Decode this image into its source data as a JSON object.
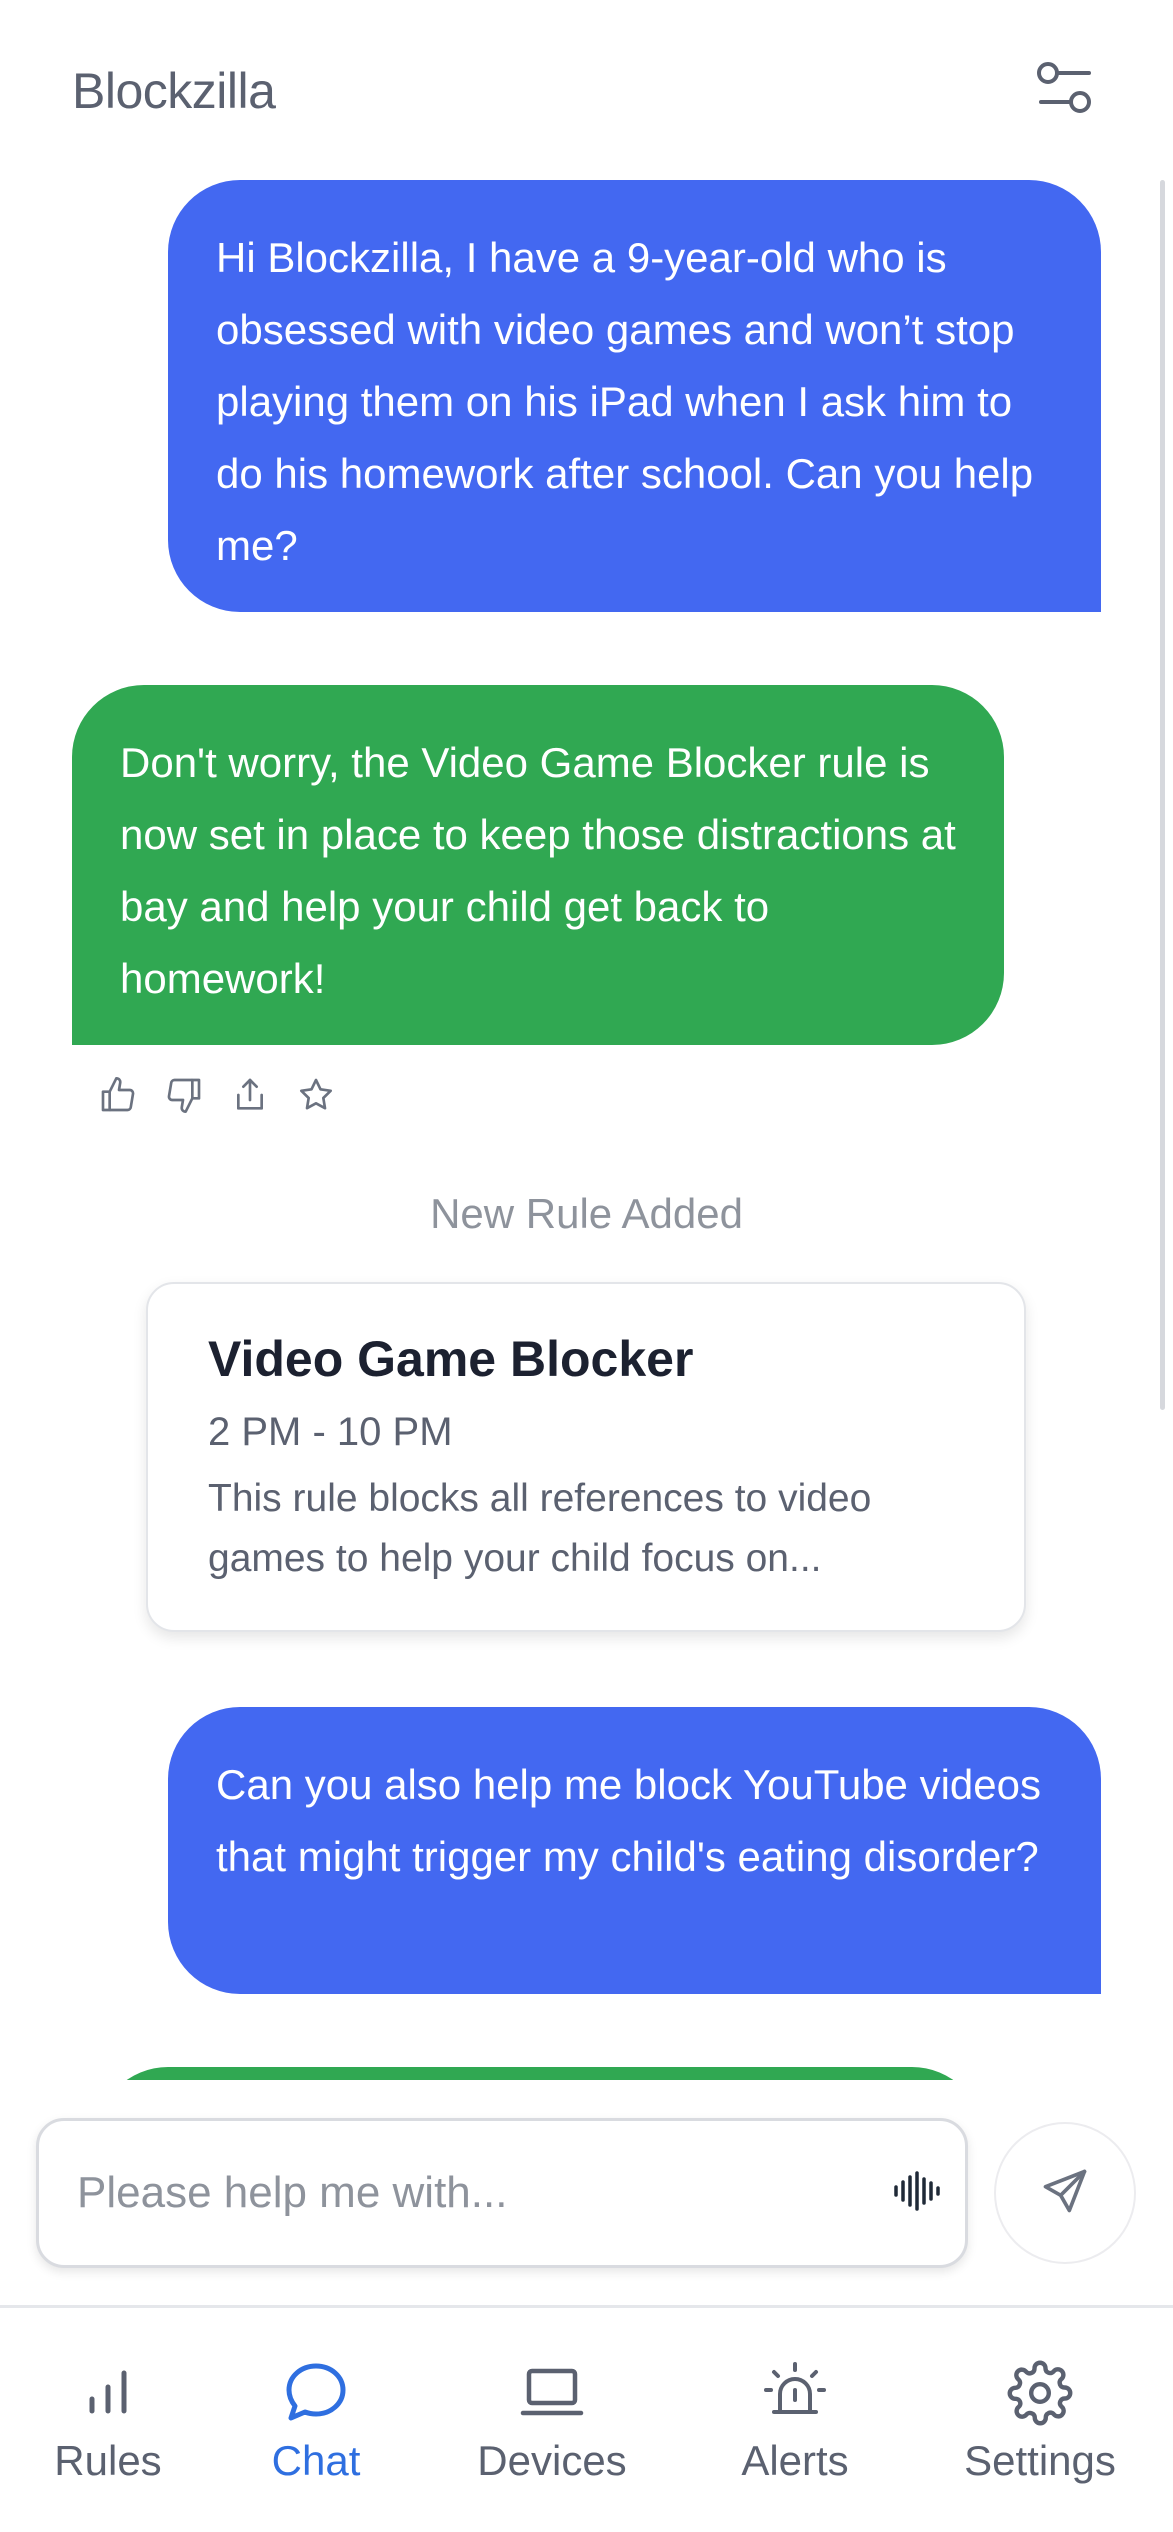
{
  "header": {
    "title": "Blockzilla",
    "filter_icon": "sliders-icon"
  },
  "messages": [
    {
      "role": "user",
      "text": "Hi Blockzilla, I have a 9-year-old who is obsessed with video games and won’t stop playing them on his iPad when I ask him to do his homework after school. Can you help me?"
    },
    {
      "role": "assistant",
      "text": "Don't worry, the Video Game Blocker rule is now set in place to keep those distractions at bay and help your child get back to homework!"
    },
    {
      "role": "user",
      "text": "Can you also help me block YouTube videos that might trigger my child's eating disorder?"
    }
  ],
  "reactions": [
    "thumbs-up-icon",
    "thumbs-down-icon",
    "share-icon",
    "star-icon"
  ],
  "system_note": "New Rule Added",
  "rule_card": {
    "title": "Video Game Blocker",
    "time": "2 PM - 10 PM",
    "description": "This rule blocks all references to video games to help your child focus on..."
  },
  "composer": {
    "placeholder": "Please help me with...",
    "mic_icon": "voice-wave-icon",
    "send_icon": "send-icon"
  },
  "tabs": [
    {
      "label": "Rules",
      "icon": "bar-chart-icon",
      "active": false
    },
    {
      "label": "Chat",
      "icon": "chat-bubble-icon",
      "active": true
    },
    {
      "label": "Devices",
      "icon": "laptop-icon",
      "active": false
    },
    {
      "label": "Alerts",
      "icon": "siren-icon",
      "active": false
    },
    {
      "label": "Settings",
      "icon": "gear-icon",
      "active": false
    }
  ],
  "colors": {
    "user_bubble": "#4368f1",
    "bot_bubble": "#30a852",
    "active_tab": "#2f6fe0",
    "muted_text": "#8e939c"
  }
}
